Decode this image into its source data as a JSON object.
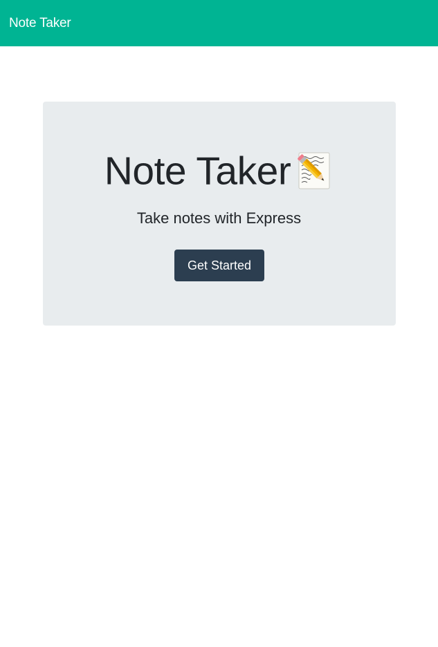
{
  "navbar": {
    "brand": "Note Taker",
    "background_color": "#00b493"
  },
  "hero": {
    "title": "Note Taker",
    "title_icon": "memo-pencil-icon",
    "subtitle": "Take notes with Express",
    "cta_label": "Get Started",
    "panel_color": "#e8ecee",
    "cta_color": "#2c3e50"
  }
}
